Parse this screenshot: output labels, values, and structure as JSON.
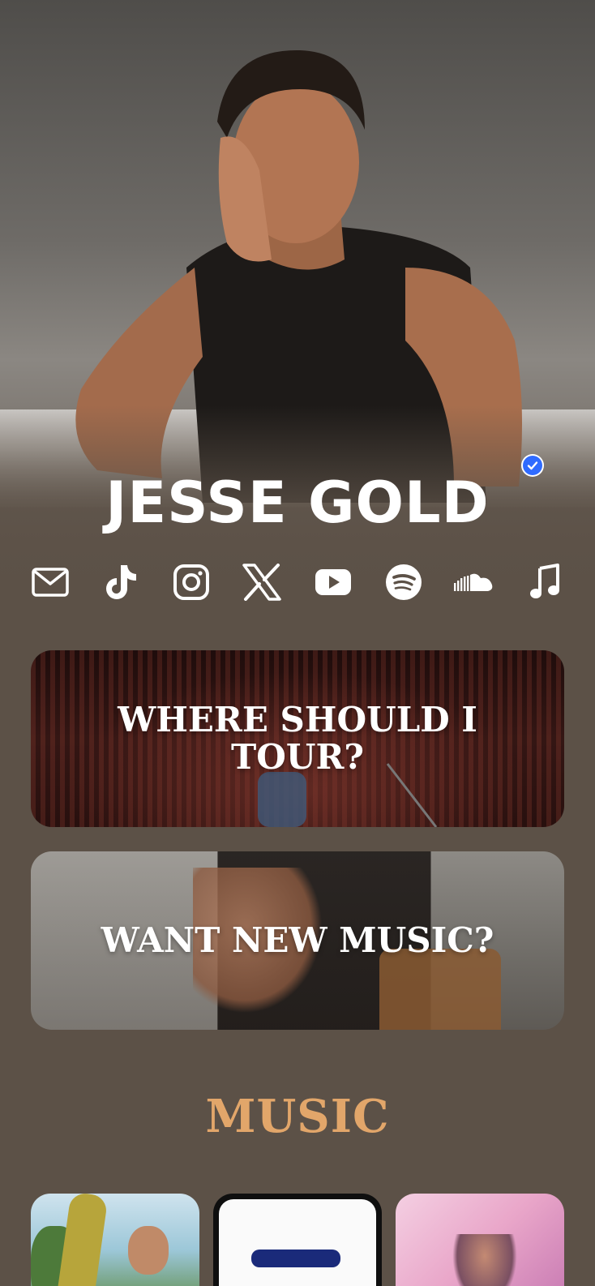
{
  "artist": {
    "name": "JESSE GOLD",
    "verified": true
  },
  "socials": [
    {
      "icon": "email-icon"
    },
    {
      "icon": "tiktok-icon"
    },
    {
      "icon": "instagram-icon"
    },
    {
      "icon": "x-icon"
    },
    {
      "icon": "youtube-icon"
    },
    {
      "icon": "spotify-icon"
    },
    {
      "icon": "soundcloud-icon"
    },
    {
      "icon": "music-note-icon"
    }
  ],
  "cards": {
    "tour": {
      "label": "WHERE SHOULD I TOUR?"
    },
    "music": {
      "label": "WANT NEW MUSIC?"
    }
  },
  "music_section": {
    "title": "MUSIC"
  },
  "colors": {
    "background": "#5c5147",
    "accent": "#e2a66a",
    "verified": "#2f6bff"
  }
}
